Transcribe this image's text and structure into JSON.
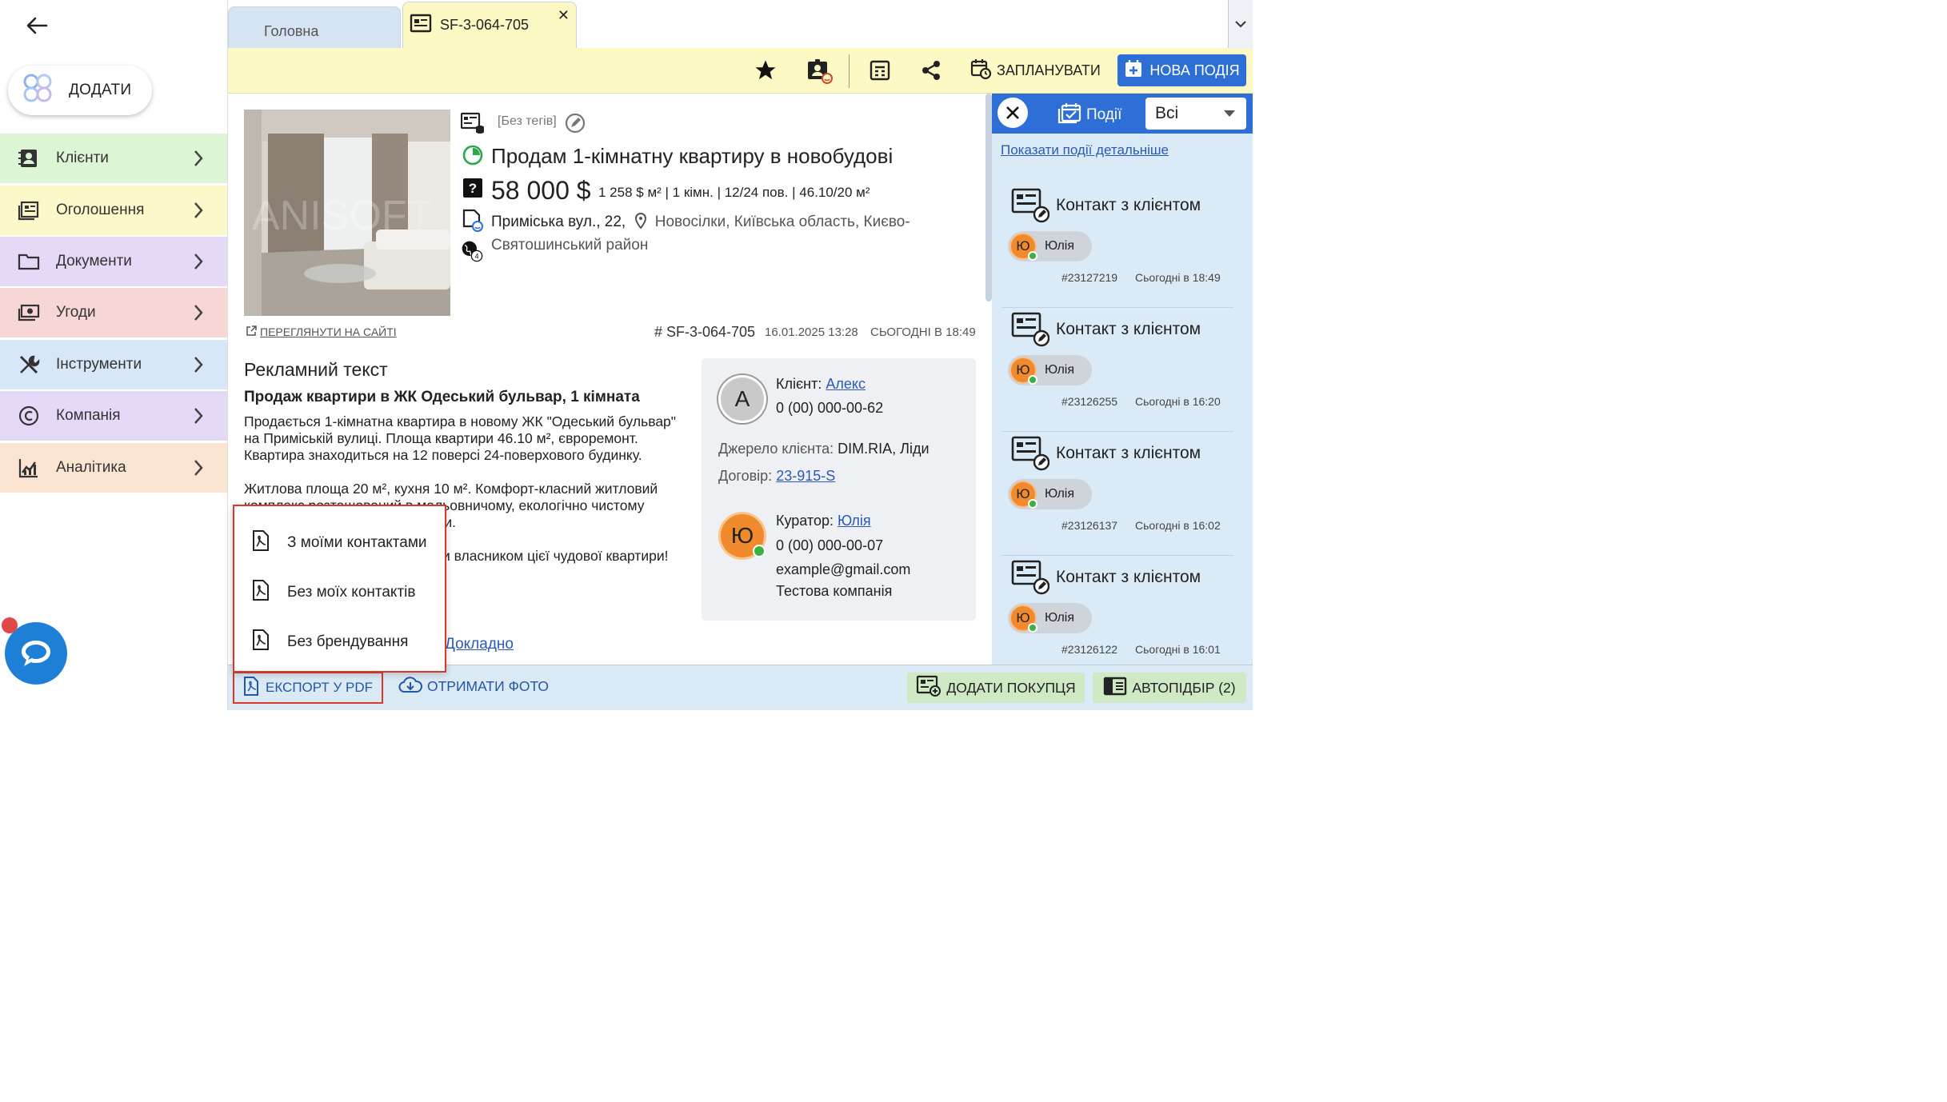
{
  "sidebar": {
    "add_label": "ДОДАТИ",
    "items": [
      {
        "label": "Клієнти",
        "icon": "contacts-icon",
        "color": "#dcf6d5"
      },
      {
        "label": "Оголошення",
        "icon": "listing-icon",
        "color": "#fbf9c9"
      },
      {
        "label": "Документи",
        "icon": "folder-icon",
        "color": "#e4d9f7"
      },
      {
        "label": "Угоди",
        "icon": "money-icon",
        "color": "#f7d7d5"
      },
      {
        "label": "Інструменти",
        "icon": "tools-icon",
        "color": "#d8e7f8"
      },
      {
        "label": "Компанія",
        "icon": "copyright-icon",
        "color": "#e4d9f7"
      },
      {
        "label": "Аналітика",
        "icon": "analytics-icon",
        "color": "#fbe5d2"
      }
    ]
  },
  "tabs": {
    "home": "Головна",
    "object": "SF-3-064-705",
    "close": "✕"
  },
  "toolbar": {
    "schedule": "ЗАПЛАНУВАТИ",
    "new_event": "НОВА ПОДІЯ"
  },
  "object": {
    "tags": "[Без тегів]",
    "title": "Продам 1-кімнатну квартиру в новобудові",
    "price": "58 000 $",
    "price_details": "1 258 $ м² | 1 кімн. | 12/24 пов. | 46.10/20 м²",
    "street": "Приміська вул., 22,",
    "location": "Новосілки, Київська область, Києво-Святошинський район",
    "globe_count": "4",
    "photo_watermark": "ANISOFT",
    "view_on_site": "ПЕРЕГЛЯНУТИ НА САЙТІ",
    "id": "# SF-3-064-705",
    "created": "16.01.2025 13:28",
    "updated": "СЬОГОДНІ В 18:49"
  },
  "ad": {
    "heading": "Рекламний текст",
    "subheading": "Продаж квартири в ЖК Одеський бульвар, 1 кімната",
    "paragraph1": "Продається 1-кімнатна квартира в новому ЖК \"Одеський бульвар\" на Приміській вулиці. Площа квартири 46.10 м², євроремонт. Квартира знаходиться на 12 поверсі 24-поверхового будинку.",
    "paragraph2": "Житлова площа 20 м², кухня 10 м². Комфорт-класний житловий комплекс розташований в мальовничому, екологічно чистому центральному районі Новосілки.",
    "paragraph3": "Не пропустіть можливість стати власником цієї чудової квартири!",
    "more": "Докладно"
  },
  "card": {
    "client_label": "Клієнт:",
    "client_name": "Алекс",
    "client_initial": "А",
    "client_phone": "0 (00) 000-00-62",
    "source_label": "Джерело клієнта:",
    "source_value": "DIM.RIA, Ліди",
    "contract_label": "Договір:",
    "contract_value": "23-915-S",
    "curator_label": "Куратор:",
    "curator_name": "Юлія",
    "curator_initial": "Ю",
    "curator_phone": "0 (00) 000-00-07",
    "curator_email": "example@gmail.com",
    "curator_company": "Тестова компанія"
  },
  "events": {
    "tab_label": "Події",
    "filter": "Всі",
    "show_detail": "Показати події детальніше",
    "items": [
      {
        "title": "Контакт з клієнтом",
        "person": "Юлія",
        "initial": "Ю",
        "id": "#23127219",
        "time": "Сьогодні в 18:49"
      },
      {
        "title": "Контакт з клієнтом",
        "person": "Юлія",
        "initial": "Ю",
        "id": "#23126255",
        "time": "Сьогодні в 16:20"
      },
      {
        "title": "Контакт з клієнтом",
        "person": "Юлія",
        "initial": "Ю",
        "id": "#23126137",
        "time": "Сьогодні в 16:02"
      },
      {
        "title": "Контакт з клієнтом",
        "person": "Юлія",
        "initial": "Ю",
        "id": "#23126122",
        "time": "Сьогодні в 16:01"
      }
    ]
  },
  "bottom": {
    "export_pdf": "ЕКСПОРТ У PDF",
    "get_photos": "ОТРИМАТИ ФОТО",
    "add_purchase": "ДОДАТИ ПОКУПЦЯ",
    "auto_select": "АВТОПІДБІР (2)"
  },
  "export_menu": [
    "З моїми контактами",
    "Без моїх контактів",
    "Без брендування"
  ],
  "colors": {
    "accent": "#2d6fd6",
    "highlight": "#d63a2a",
    "toolbar_bg": "#fdf9c4",
    "events_bg": "#dbeaf7"
  }
}
